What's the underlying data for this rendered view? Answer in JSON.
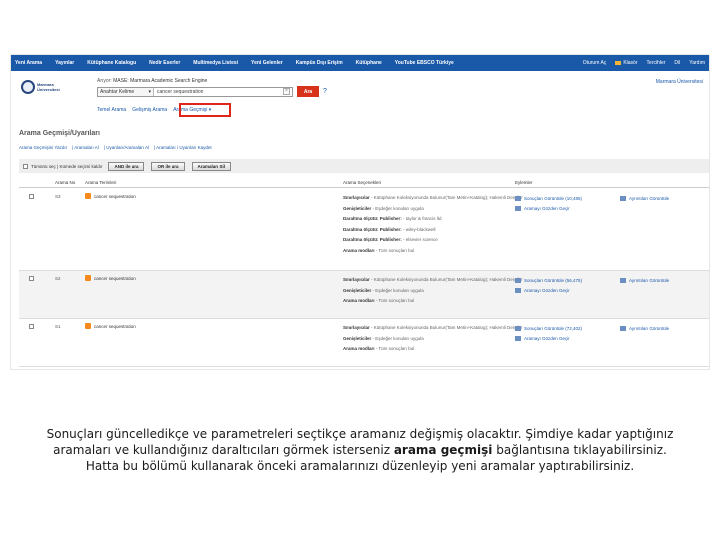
{
  "topnav": {
    "items": [
      "Yeni Arama",
      "Yayınlar",
      "Kütüphane Katalogu",
      "Nedir Eserler",
      "Multimedya Listesi",
      "Yeni Gelenler",
      "Kampüs Dışı Erişim",
      "Kütüphane",
      "YouTube EBSCO Türkiye"
    ],
    "right": [
      "Oturum Aç",
      "Klasör",
      "Tercihler",
      "Dil",
      "Yardım"
    ]
  },
  "logo": {
    "line1": "Marmara",
    "line2": "Üniversitesi"
  },
  "search": {
    "db_prefix": "Arıyor:",
    "db_name": "MASE: Marmara Academic Search Engine",
    "field_select": "Anahtar Kelime",
    "query": "cancer sequestration",
    "search_button": "Ara",
    "help": "?"
  },
  "sub_links": [
    "Temel Arama",
    "Gelişmiş Arama",
    "Arama Geçmişi"
  ],
  "institution": "Marmara Üniversitesi",
  "page_title": "Arama Geçmişi/Uyarıları",
  "crumbs": [
    "Arama Geçmişini Yazdır",
    "Aramaları Al",
    "Uyarıları/Aramaları Al",
    "Aramaları / Uyarıları Kaydet"
  ],
  "toolbar": {
    "select_all": "Tümünü seç",
    "delete_selected": "Kümede seçimi kaldır",
    "and_btn": "AND ile ara",
    "or_btn": "OR ile ara",
    "delete_btn": "Aramaları Sil"
  },
  "table": {
    "headers": [
      "Arama No",
      "Arama Terimleri",
      "Arama Seçenekleri",
      "Eylemler"
    ],
    "rows": [
      {
        "num": "S3",
        "term": "cancer sequestration",
        "options": [
          {
            "k": "Sınırlayıcılar",
            "v": " - Kütüphane Koleksiyonunda Bulunur(Tam Metin+Katalog); Hakemli Dergiler"
          },
          {
            "k": "Genişleticiler",
            "v": " - Eşdeğer konuları uygula"
          },
          {
            "k": "Daraltma ölçütü: Publisher:",
            "v": " - taylor & francis ltd"
          },
          {
            "k": "Daraltma ölçütü: Publisher:",
            "v": " - wiley-blackwell"
          },
          {
            "k": "Daraltma ölçütü: Publisher:",
            "v": " - elsevier science"
          },
          {
            "k": "Arama modları",
            "v": " - Tüm sonuçları bul"
          }
        ],
        "action1": "Sonuçları Görüntüle (10,485)",
        "action2": "Aramayı Gözden Geçir",
        "action3": "Ayrıntıları Görüntüle"
      },
      {
        "num": "S2",
        "term": "cancer sequestration",
        "options": [
          {
            "k": "Sınırlayıcılar",
            "v": " - Kütüphane Koleksiyonunda Bulunur(Tam Metin+Katalog); Hakemli Dergiler"
          },
          {
            "k": "Genişleticiler",
            "v": " - Eşdeğer konuları uygula"
          },
          {
            "k": "Arama modları",
            "v": " - Tüm sonuçları bul"
          }
        ],
        "action1": "Sonuçları Görüntüle (56,475)",
        "action2": "Aramayı Gözden Geçir",
        "action3": "Ayrıntıları Görüntüle"
      },
      {
        "num": "S1",
        "term": "cancer sequestration",
        "options": [
          {
            "k": "Sınırlayıcılar",
            "v": " - Kütüphane Koleksiyonunda Bulunur(Tam Metin+Katalog); Hakemli Dergiler"
          },
          {
            "k": "Genişleticiler",
            "v": " - Eşdeğer konuları uygula"
          },
          {
            "k": "Arama modları",
            "v": " - Tüm sonuçları bul"
          }
        ],
        "action1": "Sonuçları Görüntüle (72,402)",
        "action2": "Aramayı Gözden Geçir",
        "action3": "Ayrıntıları Görüntüle"
      }
    ]
  },
  "caption": {
    "line1": "Sonuçları güncelledikçe ve parametreleri seçtikçe aramanız değişmiş olacaktır. Şimdiye kadar yaptığınız",
    "line2_a": "aramaları ve kullandığınız daraltıcıları görmek isterseniz ",
    "line2_b": "arama geçmişi",
    "line2_c": " bağlantısına tıklayabilirsiniz.",
    "line3": "Hatta bu bölümü kullanarak önceki aramalarınızı düzenleyip yeni aramalar yaptırabilirsiniz."
  }
}
